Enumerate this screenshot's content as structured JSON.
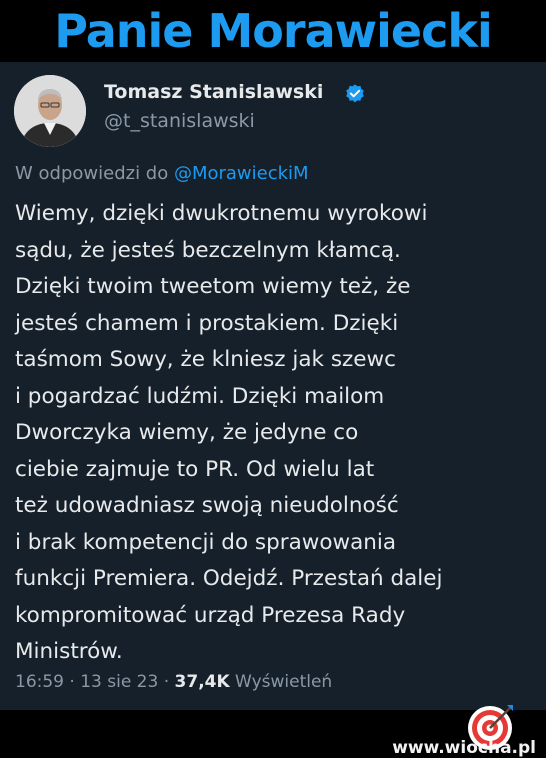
{
  "banner": {
    "title": "Panie Morawiecki"
  },
  "author": {
    "name": "Tomasz Stanislawski",
    "handle": "@t_stanislawski"
  },
  "reply": {
    "prefix": "W odpowiedzi do ",
    "mention": "@MorawieckiM"
  },
  "tweet_lines": [
    "Wiemy, dzięki dwukrotnemu wyrokowi",
    "sądu, że jesteś bezczelnym kłamcą.",
    "Dzięki twoim tweetom wiemy też, że",
    "jesteś chamem i prostakiem. Dzięki",
    "taśmom Sowy, że klniesz jak szewc",
    "i pogardzać ludźmi.  Dzięki mailom",
    "Dworczyka wiemy, że jedyne co",
    "ciebie zajmuje to PR. Od  wielu lat",
    "też udowadniasz swoją nieudolność",
    "i brak kompetencji do sprawowania",
    "funkcji Premiera. Odejdź. Przestań dalej",
    "kompromitować urząd Prezesa Rady",
    "Ministrów."
  ],
  "meta": {
    "time": "16:59 · 13 sie 23 · ",
    "views": "37,4K",
    "views_label": " Wyświetleń"
  },
  "watermark": "www.wiocha.pl",
  "colors": {
    "accent": "#1d9bf0",
    "card_bg": "#15202b",
    "text": "#e7e9ea",
    "muted": "#8b98a5"
  }
}
